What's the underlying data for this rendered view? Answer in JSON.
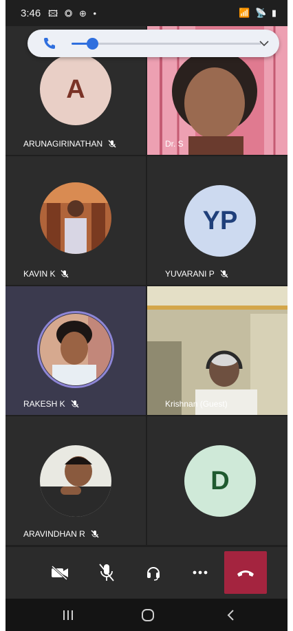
{
  "status_bar": {
    "time": "3:46",
    "left_icons": "🖾 ◎ ⊕ •",
    "right_icons": "📶 📡 ▮"
  },
  "volume": {
    "level": 0.11,
    "accent": "#2f6fde"
  },
  "participants": [
    {
      "name": "ARUNAGIRINATHAN",
      "initials": "A",
      "muted": true,
      "avatar_bg": "#e9cfc6",
      "avatar_fg": "#7a3327"
    },
    {
      "name": "Dr. S",
      "initials": "",
      "muted": false,
      "video": true
    },
    {
      "name": "KAVIN K",
      "initials": "",
      "muted": true,
      "photo": true
    },
    {
      "name": "YUVARANI P",
      "initials": "YP",
      "muted": true,
      "avatar_bg": "#cddaf0",
      "avatar_fg": "#1f3f7a"
    },
    {
      "name": "RAKESH K",
      "initials": "",
      "muted": true,
      "photo": true,
      "speaking": true
    },
    {
      "name": "Krishnan (Guest)",
      "initials": "",
      "muted": false,
      "video": true
    },
    {
      "name": "ARAVINDHAN R",
      "initials": "",
      "muted": true,
      "photo": true
    },
    {
      "name": "",
      "initials": "D",
      "muted": false,
      "avatar_bg": "#cfe9d8",
      "avatar_fg": "#1f5a2f"
    }
  ],
  "call_controls": {
    "camera_off": "camera-off",
    "mic_off": "mic-off",
    "audio": "headset",
    "more": "more",
    "hang_up": "hang-up",
    "hang_up_color": "#a4243f"
  },
  "nav": [
    "recents",
    "home",
    "back"
  ]
}
